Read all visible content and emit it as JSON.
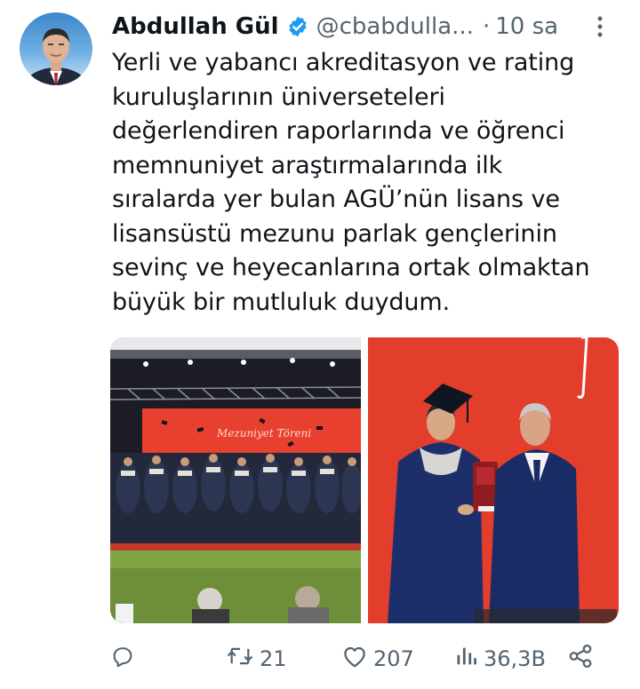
{
  "author": {
    "name": "Abdullah Gül",
    "handle": "@cbabdulla...",
    "separator": "·",
    "time": "10 sa"
  },
  "tweet": {
    "text": "Yerli ve yabancı akreditasyon ve rating\nkuruluşlarının üniverseteleri\ndeğerlendiren raporlarında ve öğrenci\nmemnuniyet araştırmalarında ilk\nsıralarda yer bulan AGÜ’nün lisans ve\nlisansüstü mezunu parlak gençlerinin\nsevinç ve heyecanlarına ortak olmaktan\nbüyük bir mutluluk duydum."
  },
  "media": {
    "left_photo_banner": "Mezuniyet Töreni"
  },
  "actions": {
    "reply_count": "",
    "retweet_count": "21",
    "like_count": "207",
    "views_count": "36,3B"
  },
  "colors": {
    "verified": "#1d9bf0",
    "muted": "#536471",
    "text": "#0f1419",
    "stage_red": "#e8402e"
  },
  "icons": [
    "verified-badge-icon",
    "more-icon",
    "reply-icon",
    "retweet-icon",
    "like-icon",
    "views-icon",
    "share-icon"
  ]
}
